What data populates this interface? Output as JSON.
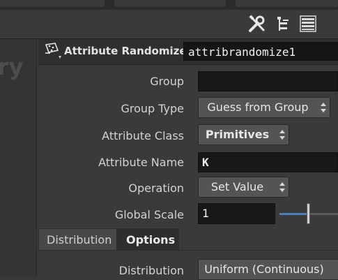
{
  "toolbar": {
    "icons": [
      "wrench-screwdriver-icon",
      "tree-view-icon",
      "list-icon"
    ]
  },
  "left_panel": {
    "ghost_text": "ry"
  },
  "header": {
    "node_type": "Attribute Randomize",
    "node_name": "attribrandomize1",
    "icon": "dice-icon"
  },
  "parameters": {
    "group": {
      "label": "Group",
      "value": ""
    },
    "group_type": {
      "label": "Group Type",
      "value": "Guess from Group"
    },
    "attribute_class": {
      "label": "Attribute Class",
      "value": "Primitives"
    },
    "attribute_name": {
      "label": "Attribute Name",
      "value": "K"
    },
    "operation": {
      "label": "Operation",
      "value": "Set Value"
    },
    "global_scale": {
      "label": "Global Scale",
      "value": "1"
    }
  },
  "tabs": [
    {
      "label": "Distribution",
      "active": false
    },
    {
      "label": "Options",
      "active": true
    }
  ],
  "options": {
    "distribution": {
      "label": "Distribution",
      "value": "Uniform (Continuous)"
    }
  },
  "colors": {
    "slider_accent": "#4b7fb8",
    "field_bg": "#181818",
    "panel_bg": "#3a3a3a"
  }
}
